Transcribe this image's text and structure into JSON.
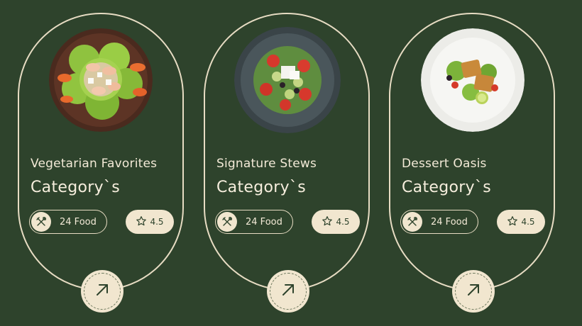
{
  "cards": [
    {
      "name": "Vegetarian Favorites",
      "label": "Category`s",
      "food_count": "24 Food",
      "rating": "4.5",
      "icons": {
        "food": "fork-knife-icon",
        "rating": "star-icon",
        "action": "arrow-up-right-icon"
      }
    },
    {
      "name": "Signature Stews",
      "label": "Category`s",
      "food_count": "24 Food",
      "rating": "4.5",
      "icons": {
        "food": "fork-knife-icon",
        "rating": "star-icon",
        "action": "arrow-up-right-icon"
      }
    },
    {
      "name": "Dessert Oasis",
      "label": "Category`s",
      "food_count": "24 Food",
      "rating": "4.5",
      "icons": {
        "food": "fork-knife-icon",
        "rating": "star-icon",
        "action": "arrow-up-right-icon"
      }
    }
  ],
  "colors": {
    "background": "#2e432c",
    "outline": "#e7dcc3",
    "cream": "#f1e6cf",
    "text": "#f3ead7"
  }
}
